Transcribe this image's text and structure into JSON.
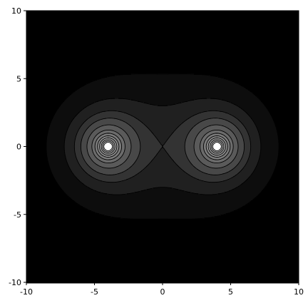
{
  "chart_data": {
    "type": "contour",
    "title": "",
    "xlabel": "",
    "ylabel": "",
    "xlim": [
      -10,
      10
    ],
    "ylim": [
      -10,
      10
    ],
    "x_ticks": [
      -10,
      -5,
      0,
      5,
      10
    ],
    "y_ticks": [
      -10,
      -5,
      0,
      5,
      10
    ],
    "x_tick_labels": [
      "-10",
      "-5",
      "0",
      "5",
      "10"
    ],
    "y_tick_labels": [
      "-10",
      "-5",
      "0",
      "5",
      "10"
    ],
    "sources": [
      {
        "x": -4,
        "y": 0
      },
      {
        "x": 4,
        "y": 0
      }
    ],
    "field": "sum of inverse distances to the two sources",
    "contour_levels": [
      0.3,
      0.4,
      0.5,
      0.6,
      0.75,
      0.95,
      1.15,
      1.4,
      1.7,
      2.1,
      2.6,
      3.4
    ],
    "band_colors": [
      "#000000",
      "#0d0d0d",
      "#202020",
      "#333333",
      "#484848",
      "#5a5a5a",
      "#6b6b6b",
      "#7b7b7b",
      "#8a8a8a",
      "#9a9a9a",
      "#aaaaaa",
      "#bebebe",
      "#ffffff"
    ],
    "contour_line_color": "#000000",
    "grid": false,
    "legend": "none"
  }
}
